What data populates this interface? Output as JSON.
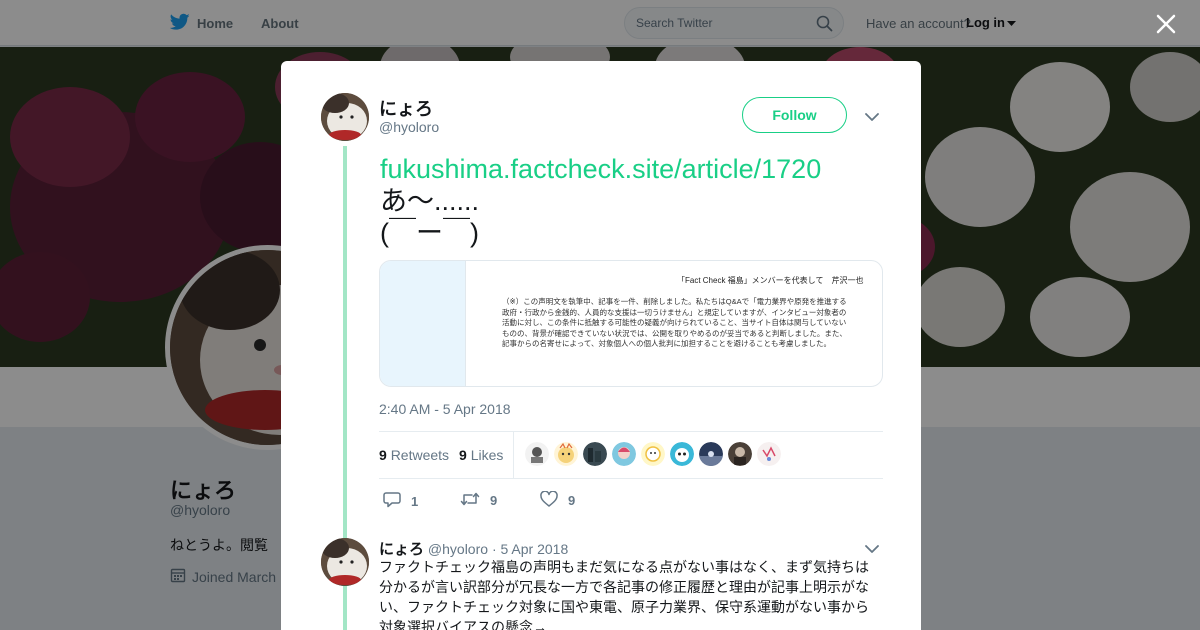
{
  "nav": {
    "home_label": "Home",
    "about_label": "About",
    "search_placeholder": "Search Twitter",
    "have_account": "Have an account?",
    "login_label": "Log in"
  },
  "profile_bg": {
    "name": "にょろ",
    "handle": "@hyoloro",
    "bio": "ねとうよ。閲覧",
    "joined": "Joined March"
  },
  "tweet": {
    "author_name": "にょろ",
    "author_handle": "@hyoloro",
    "follow_label": "Follow",
    "link": "fukushima.factcheck.site/article/1720",
    "lines": [
      "あ～......",
      "(￣ー￣)"
    ],
    "card": {
      "signature": "「Fact Check 福島」メンバーを代表して　芹沢一也",
      "body": "（※）この声明文を執筆中、記事を一件、削除しました。私たちはQ&Aで「電力業界や原発を推進する政府・行政から金銭的、人員的な支援は一切うけません」と規定していますが、インタビュー対象者の活動に対し、この条件に抵触する可能性の疑義が向けられていること、当サイト自体は関与していないものの、背景が確認できていない状況では、公開を取りやめるのが妥当であると判断しました。また、記事からの名寄せによって、対象個人への個人批判に加担することを避けることも考慮しました。"
    },
    "timestamp": "2:40 AM - 5 Apr 2018",
    "retweets_count": "9",
    "retweets_label": "Retweets",
    "likes_count": "9",
    "likes_label": "Likes",
    "reply_count": "1",
    "retweet_action_count": "9",
    "like_action_count": "9"
  },
  "reply": {
    "author_name": "にょろ",
    "author_handle": "@hyoloro",
    "separator": "·",
    "date": "5 Apr 2018",
    "text": "ファクトチェック福島の声明もまだ気になる点がない事はなく、まず気持ちは分かるが言い訳部分が冗長な一方で各記事の修正履歴と理由が記事上明示がない、ファクトチェック対象に国や東電、原子力業界、保守系運動がない事から対象選択バイアスの懸念→"
  },
  "colors": {
    "accent": "#19cf86",
    "thread_line": "#a3e6c6",
    "muted": "#657786"
  }
}
